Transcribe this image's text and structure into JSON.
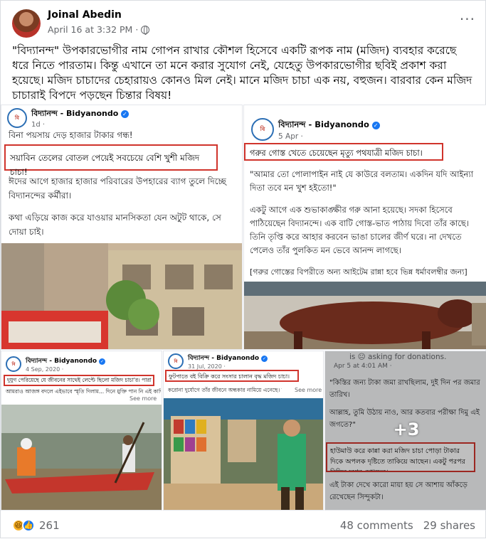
{
  "post": {
    "author": "Joinal Abedin",
    "timestamp": "April 16 at 3:32 PM",
    "dot": "·",
    "menu": "···",
    "text": "\"বিদ্যানন্দ\" উপকারভোগীর নাম গোপন রাখার কৌশল হিসেবে একটি রূপক নাম (মজিদ) ব্যবহার করেছে ধরে নিতে পারতাম। কিন্তু এখানে তা মনে করার সুযোগ নেই, যেহেতু উপকারভোগীর ছবিই প্রকাশ করা হয়েছে। মজিদ চাচাদের চেহারায়ও কোনও মিল নেই। মানে মজিদ চাচা এক নয়, বহুজন। বারবার কেন মজিদ চাচারাই বিপদে পড়ছেন চিন্তার বিষয়!"
  },
  "tiles": {
    "t1": {
      "page": "বিদ্যানন্দ - Bidyanondo",
      "date": "1d ·",
      "line1": "বিনা পয়সায় দেড় হাজার টাকার গন্ধ!",
      "highlight": "সয়াবিন তেলের বোতল পেয়েই সবচেয়ে বেশি খুশী মজিদ চাচা!",
      "para1": "ঈদের আগে হাজার হাজার পরিবারের উপহারের ব্যাগ তুলে দিচ্ছে বিদ্যানন্দের কর্মীরা।",
      "para2": "কথা এড়িয়ে কাজ করে যাওয়ার মানসিকতা যেন অটুট থাকে, সে দোয়া চাই।"
    },
    "t2": {
      "page": "বিদ্যানন্দ - Bidyanondo",
      "date": "5 Apr ·",
      "highlight": "গরুর গোস্ত খেতে চেয়েছেন মৃত্যু পথযাত্রী মজিদ চাচা।",
      "quote": "\"আমার তো পোলাপাইন নাই যে কাউরে বলতাম। একদিন যদি আইন্যা দিতা তবে মন খুশ হইতো!\"",
      "para1": "একটু আগে এক শুভাকাঙ্ক্ষীর গরু আনা হয়েছে। সদকা হিসেবে পাঠিয়েছেন বিদ্যানন্দে। এক বাটি গোস্ত-ভাত পাঠায় দিবো তাঁর কাছে। তিনি তৃপ্তি করে আহার করবেন ভাঙা চালের জীর্ণ ঘরে। না দেখতে পেলেও তাঁর পুলকিত মন ভেবে আনন্দ লাগছে।",
      "para2": "[গরুর গোস্তের বিপরীতে অন্য আইটেম রান্না হবে ভিন্ন ধর্মাবলম্বীর জন্য]"
    },
    "t3": {
      "page": "বিদ্যানন্দ - Bidyanondo",
      "date": "4 Sep, 2020 ·",
      "highlight": "দুযুগ পেরিয়েছে যে জীবনের সাথেই লেপ্টে ছিলো মজিদ চাচা'র। পারা",
      "line2": "আমরাও আজঙ্গ বদলে এইভাবে স্মৃতি দিলাম... দিনে মুক্তি পান নি এই কাদিয়া থেকে।",
      "seemore": "See more"
    },
    "t4": {
      "page": "বিদ্যানন্দ - Bidyanondo",
      "date": "31 Jul, 2020 ·",
      "highlight": "ফুটপাতে বই বিক্রি করে সংসার চালান বৃদ্ধ মজিদ চাচা।",
      "line2": "করোনা দুর্যোগে তাঁর জীবনে অন্ধকার নামিয়ে এনেছে। বিক্রি...",
      "seemore": "See more"
    },
    "t5": {
      "top": "is 😐 asking for donations.",
      "date": "Apr 5 at 4:01 AM ·",
      "quote": "\"কিস্তির জন্য টাকা জমা রাখছিলাম, দুই দিন পর জমার তারিখ।",
      "line2": "আল্লাহ, তুমি উঠায় নাও, আর কতবার পরীক্ষা দিমু এই জগতে?\"",
      "highlight": "হাউমাউ করে কান্না করা মজিদ চাচা পোড়া টাকার দিকে অপলক দৃষ্টিতে তাকিয়ে আছেন। একটু পরপর বিভিন্ন দুয়ার দেখছেন।",
      "line3": "এই টাকা দেখে কারো মায়া হয় সে আশায় আঁকড়ে রেখেছেন সিন্দুকটা।",
      "overlay": "+3"
    }
  },
  "footer": {
    "reactions": "261",
    "comments": "48 comments",
    "shares": "29 shares"
  },
  "colors": {
    "highlight_border": "#d0342c",
    "brand_blue": "#1877f2"
  }
}
